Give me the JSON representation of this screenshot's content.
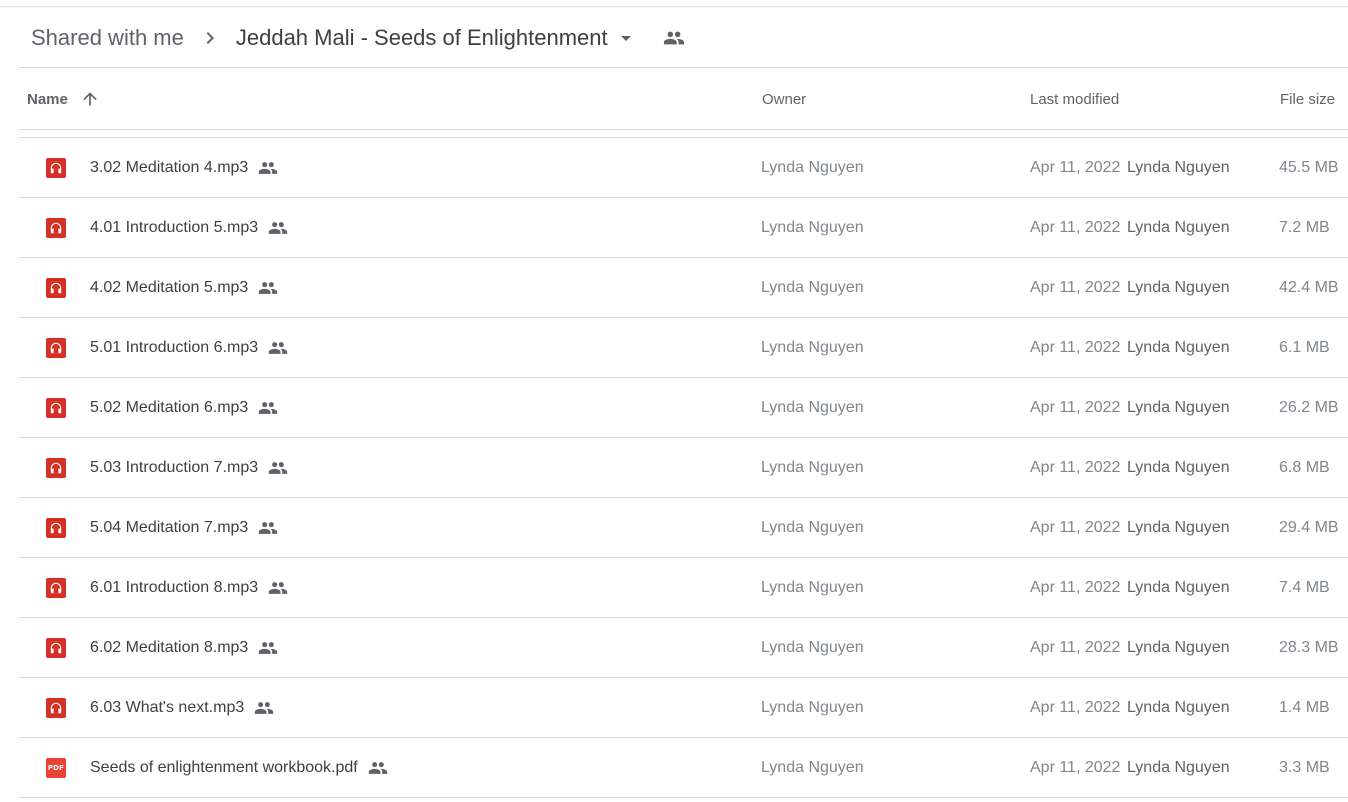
{
  "breadcrumb": {
    "parent": "Shared with me",
    "current": "Jeddah Mali - Seeds of Enlightenment"
  },
  "columns": {
    "name": "Name",
    "owner": "Owner",
    "last_modified": "Last modified",
    "file_size": "File size"
  },
  "colors": {
    "audio_icon": "#d93025",
    "pdf_icon": "#ea4335"
  },
  "files": [
    {
      "name": "3.02 Meditation 4.mp3",
      "type": "audio",
      "owner": "Lynda Nguyen",
      "modified_date": "Apr 11, 2022",
      "modified_by": "Lynda Nguyen",
      "size": "45.5 MB"
    },
    {
      "name": "4.01 Introduction 5.mp3",
      "type": "audio",
      "owner": "Lynda Nguyen",
      "modified_date": "Apr 11, 2022",
      "modified_by": "Lynda Nguyen",
      "size": "7.2 MB"
    },
    {
      "name": "4.02 Meditation 5.mp3",
      "type": "audio",
      "owner": "Lynda Nguyen",
      "modified_date": "Apr 11, 2022",
      "modified_by": "Lynda Nguyen",
      "size": "42.4 MB"
    },
    {
      "name": "5.01 Introduction 6.mp3",
      "type": "audio",
      "owner": "Lynda Nguyen",
      "modified_date": "Apr 11, 2022",
      "modified_by": "Lynda Nguyen",
      "size": "6.1 MB"
    },
    {
      "name": "5.02 Meditation 6.mp3",
      "type": "audio",
      "owner": "Lynda Nguyen",
      "modified_date": "Apr 11, 2022",
      "modified_by": "Lynda Nguyen",
      "size": "26.2 MB"
    },
    {
      "name": "5.03 Introduction 7.mp3",
      "type": "audio",
      "owner": "Lynda Nguyen",
      "modified_date": "Apr 11, 2022",
      "modified_by": "Lynda Nguyen",
      "size": "6.8 MB"
    },
    {
      "name": "5.04 Meditation 7.mp3",
      "type": "audio",
      "owner": "Lynda Nguyen",
      "modified_date": "Apr 11, 2022",
      "modified_by": "Lynda Nguyen",
      "size": "29.4 MB"
    },
    {
      "name": "6.01 Introduction 8.mp3",
      "type": "audio",
      "owner": "Lynda Nguyen",
      "modified_date": "Apr 11, 2022",
      "modified_by": "Lynda Nguyen",
      "size": "7.4 MB"
    },
    {
      "name": "6.02 Meditation 8.mp3",
      "type": "audio",
      "owner": "Lynda Nguyen",
      "modified_date": "Apr 11, 2022",
      "modified_by": "Lynda Nguyen",
      "size": "28.3 MB"
    },
    {
      "name": "6.03 What's next.mp3",
      "type": "audio",
      "owner": "Lynda Nguyen",
      "modified_date": "Apr 11, 2022",
      "modified_by": "Lynda Nguyen",
      "size": "1.4 MB"
    },
    {
      "name": "Seeds of enlightenment workbook.pdf",
      "type": "pdf",
      "owner": "Lynda Nguyen",
      "modified_date": "Apr 11, 2022",
      "modified_by": "Lynda Nguyen",
      "size": "3.3 MB",
      "icon_label": "PDF"
    }
  ]
}
